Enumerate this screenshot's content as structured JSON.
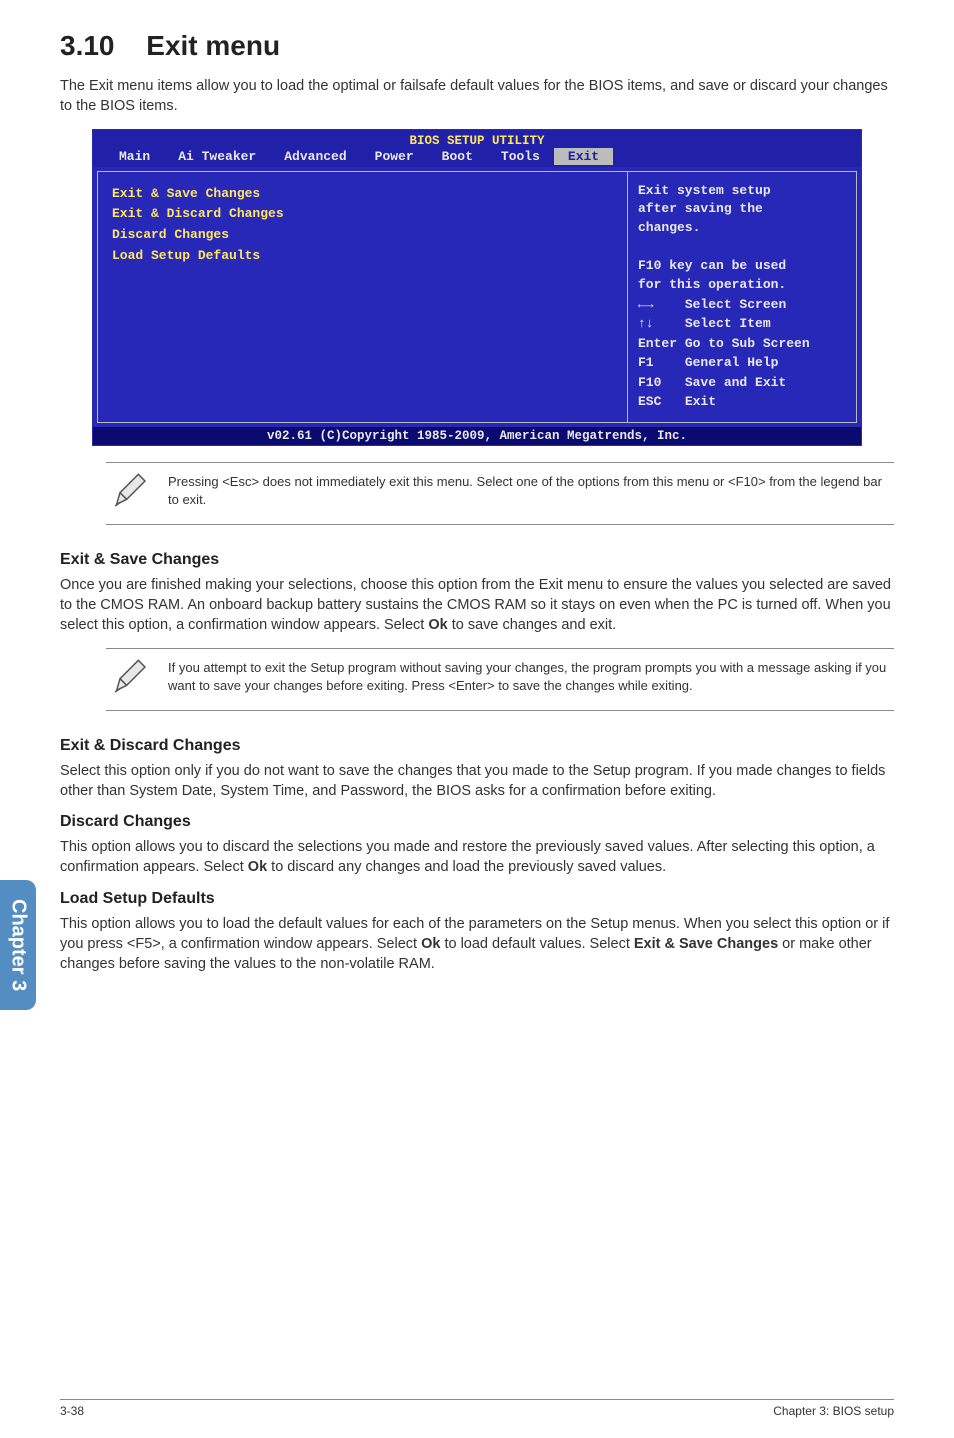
{
  "sideTab": "Chapter 3",
  "heading": {
    "num": "3.10",
    "title": "Exit menu"
  },
  "intro": "The Exit menu items allow you to load the optimal or failsafe default values for the BIOS items, and save or discard your changes to the BIOS items.",
  "bios": {
    "title": "BIOS SETUP UTILITY",
    "tabs": [
      "Main",
      "Ai Tweaker",
      "Advanced",
      "Power",
      "Boot",
      "Tools",
      "Exit"
    ],
    "activeTab": "Exit",
    "menuItems": [
      "Exit & Save Changes",
      "Exit & Discard Changes",
      "Discard Changes",
      "",
      "Load Setup Defaults"
    ],
    "helpTop": [
      "Exit system setup",
      "after saving the",
      "changes.",
      "",
      "F10 key can be used",
      "for this operation."
    ],
    "legend": [
      {
        "k": "←→",
        "v": "Select Screen"
      },
      {
        "k": "↑↓",
        "v": "Select Item"
      },
      {
        "k": "Enter",
        "v": "Go to Sub Screen"
      },
      {
        "k": "F1",
        "v": "General Help"
      },
      {
        "k": "F10",
        "v": "Save and Exit"
      },
      {
        "k": "ESC",
        "v": "Exit"
      }
    ],
    "footer": "v02.61 (C)Copyright 1985-2009, American Megatrends, Inc."
  },
  "note1": "Pressing <Esc> does not immediately exit this menu. Select one of the options from this menu or <F10> from the legend bar to exit.",
  "sections": {
    "s1": {
      "title": "Exit & Save Changes",
      "bodyA": "Once you are finished making your selections, choose this option from the Exit menu to ensure the values you selected are saved to the CMOS RAM. An onboard backup battery sustains the CMOS RAM so it stays on even when the PC is turned off. When you select this option, a confirmation window appears. Select ",
      "bold": "Ok",
      "bodyB": " to save changes and exit."
    },
    "note2": "If you attempt to exit the Setup program without saving your changes, the program prompts you with a message asking if you want to save your changes before exiting. Press <Enter> to save the changes while exiting.",
    "s2": {
      "title": "Exit & Discard Changes",
      "body": "Select this option only if you do not want to save the changes that you  made to the Setup program. If you made changes to fields other than System Date, System Time, and Password, the BIOS asks for a confirmation before exiting."
    },
    "s3": {
      "title": "Discard Changes",
      "bodyA": "This option allows you to discard the selections you made and restore the previously saved values. After selecting this option, a confirmation appears. Select ",
      "bold": "Ok",
      "bodyB": " to discard any changes and load the previously saved values."
    },
    "s4": {
      "title": "Load Setup Defaults",
      "bodyA": "This option allows you to load the default values for each of the parameters on the Setup menus. When you select this option or if you press <F5>, a confirmation window appears. Select ",
      "bold1": "Ok",
      "bodyB": " to load default values. Select ",
      "bold2": "Exit & Save Changes",
      "bodyC": " or make other changes before saving the values to the non-volatile RAM."
    }
  },
  "footer": {
    "left": "3-38",
    "right": "Chapter 3: BIOS setup"
  }
}
